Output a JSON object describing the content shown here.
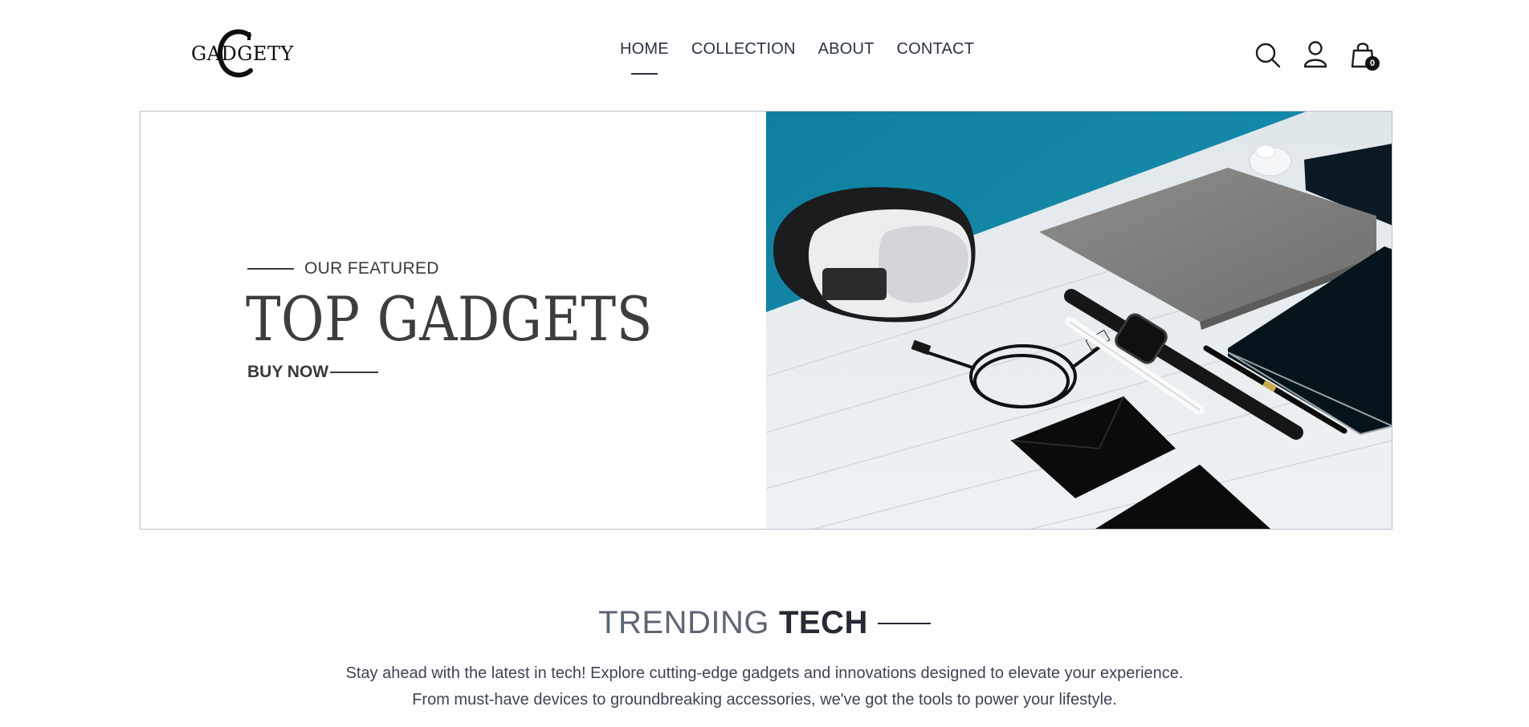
{
  "brand": {
    "name": "GADGETY"
  },
  "nav": {
    "items": [
      {
        "label": "HOME",
        "active": true
      },
      {
        "label": "COLLECTION",
        "active": false
      },
      {
        "label": "ABOUT",
        "active": false
      },
      {
        "label": "CONTACT",
        "active": false
      }
    ]
  },
  "header_icons": {
    "search": "search-icon",
    "account": "user-icon",
    "cart": "shopping-bag-icon",
    "cart_count": "0"
  },
  "hero": {
    "eyebrow": "OUR FEATURED",
    "title": "TOP GADGETS",
    "cta": "BUY NOW"
  },
  "trending": {
    "heading_light": "TRENDING",
    "heading_bold": "TECH",
    "desc_line1": "Stay ahead with the latest in tech! Explore cutting-edge gadgets and innovations designed to elevate your experience.",
    "desc_line2": "From must-have devices to groundbreaking accessories, we've got the tools to power your lifestyle."
  },
  "colors": {
    "text_dark": "#262b35",
    "text_muted": "#5e6674",
    "hero_border": "#b9c0cc",
    "photo_wall": "#1987a8",
    "photo_table": "#e7ecef"
  }
}
